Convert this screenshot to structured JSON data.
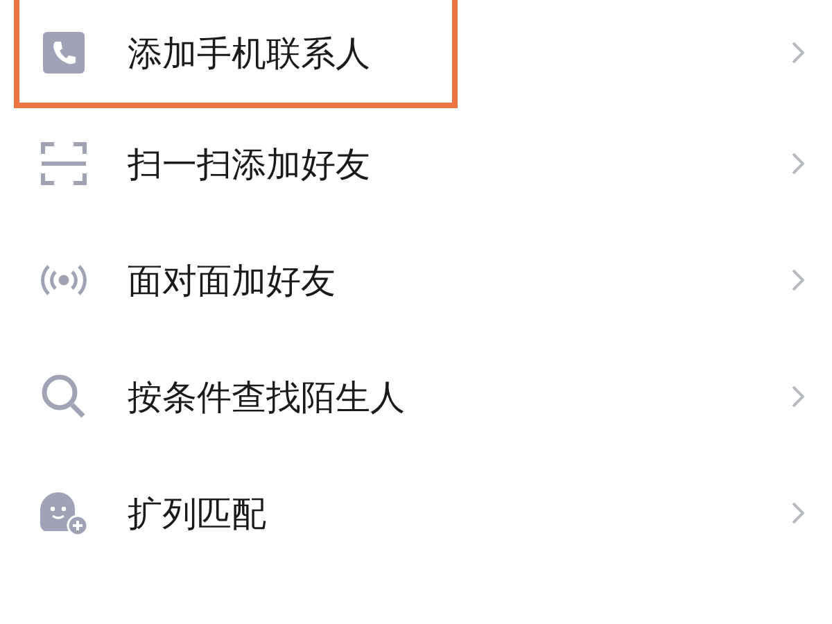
{
  "menu": {
    "items": [
      {
        "label": "添加手机联系人",
        "highlighted": true
      },
      {
        "label": "扫一扫添加好友",
        "highlighted": false
      },
      {
        "label": "面对面加好友",
        "highlighted": false
      },
      {
        "label": "按条件查找陌生人",
        "highlighted": false
      },
      {
        "label": "扩列匹配",
        "highlighted": false
      }
    ]
  }
}
